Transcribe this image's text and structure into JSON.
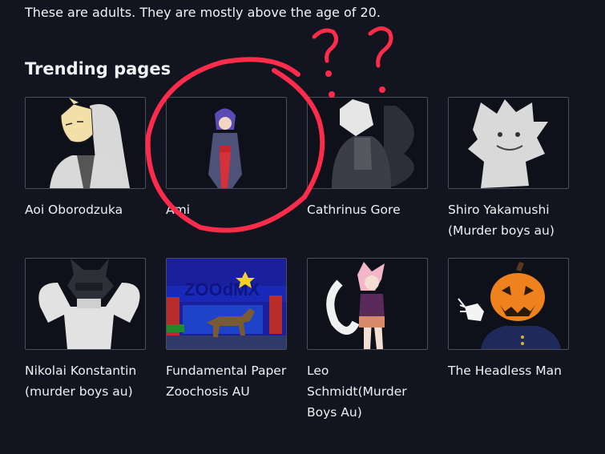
{
  "intro_text": "These are adults. They are mostly above the age of 20.",
  "section_title": "Trending pages",
  "pages": [
    {
      "label": "Aoi Oborodzuka"
    },
    {
      "label": "Ami"
    },
    {
      "label": "Cathrinus Gore"
    },
    {
      "label": "Shiro Yakamushi (Murder boys au)"
    },
    {
      "label": "Nikolai Konstantin (murder boys au)"
    },
    {
      "label": "Fundamental Paper Zoochosis AU"
    },
    {
      "label": "Leo Schmidt(Murder Boys Au)"
    },
    {
      "label": "The Headless Man"
    }
  ],
  "annotations": {
    "marks": "? ?",
    "circle_color": "#ff2b4a"
  },
  "thumbnail_text": {
    "zoo_sign": "ZOOdMX"
  }
}
